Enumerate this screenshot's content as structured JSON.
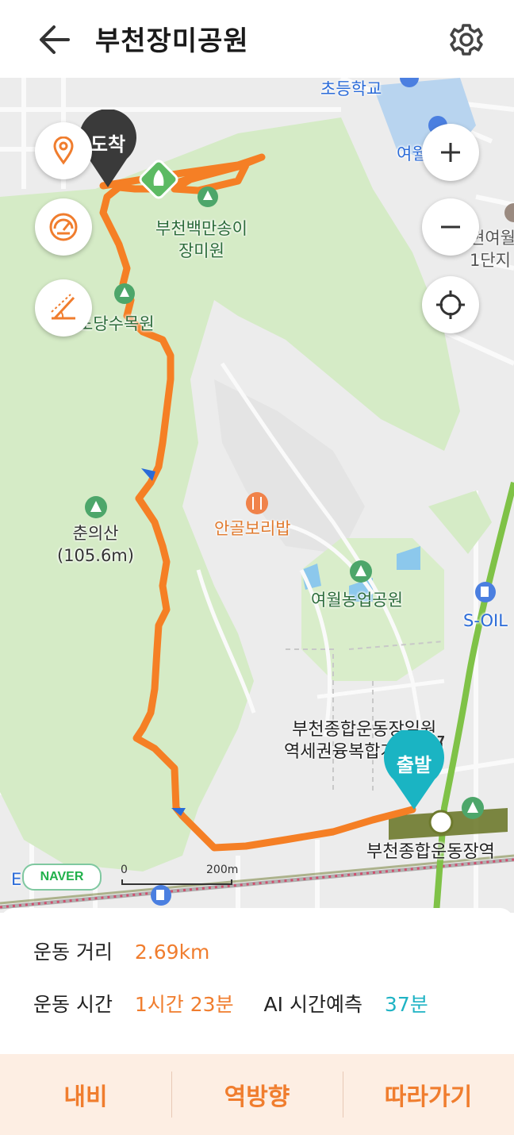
{
  "header": {
    "title": "부천장미공원"
  },
  "map": {
    "labels": {
      "school": "초등학교",
      "yeowol1": "여월",
      "apartment": "현여월\n1단지",
      "rose_garden": "부천백만송이\n장미원",
      "dosu_park": "도당수목원",
      "chunui_mountain": "춘의산\n(105.6m)",
      "restaurant": "안골보리밥",
      "farm_park": "여월농업공원",
      "soil": "S-OIL",
      "project": "부천종합운동장일원\n역세권융복합개발사업",
      "station": "부천종합운동장역",
      "e_label": "E"
    },
    "pins": {
      "arrival": "도착",
      "departure": "출발"
    },
    "subway_line": "7",
    "naver": "NAVER",
    "scale": {
      "zero": "0",
      "dist": "200m"
    }
  },
  "stats": {
    "distance_label": "운동 거리",
    "distance_value": "2.69km",
    "time_label": "운동 시간",
    "time_value": "1시간 23분",
    "ai_label": "AI 시간예측",
    "ai_value": "37분"
  },
  "bottom": {
    "navi": "내비",
    "reverse": "역방향",
    "follow": "따라가기"
  },
  "colors": {
    "route": "#f57f25",
    "accent": "#f07d2e",
    "teal": "#1fb3c4",
    "park": "#d4ebc5"
  }
}
